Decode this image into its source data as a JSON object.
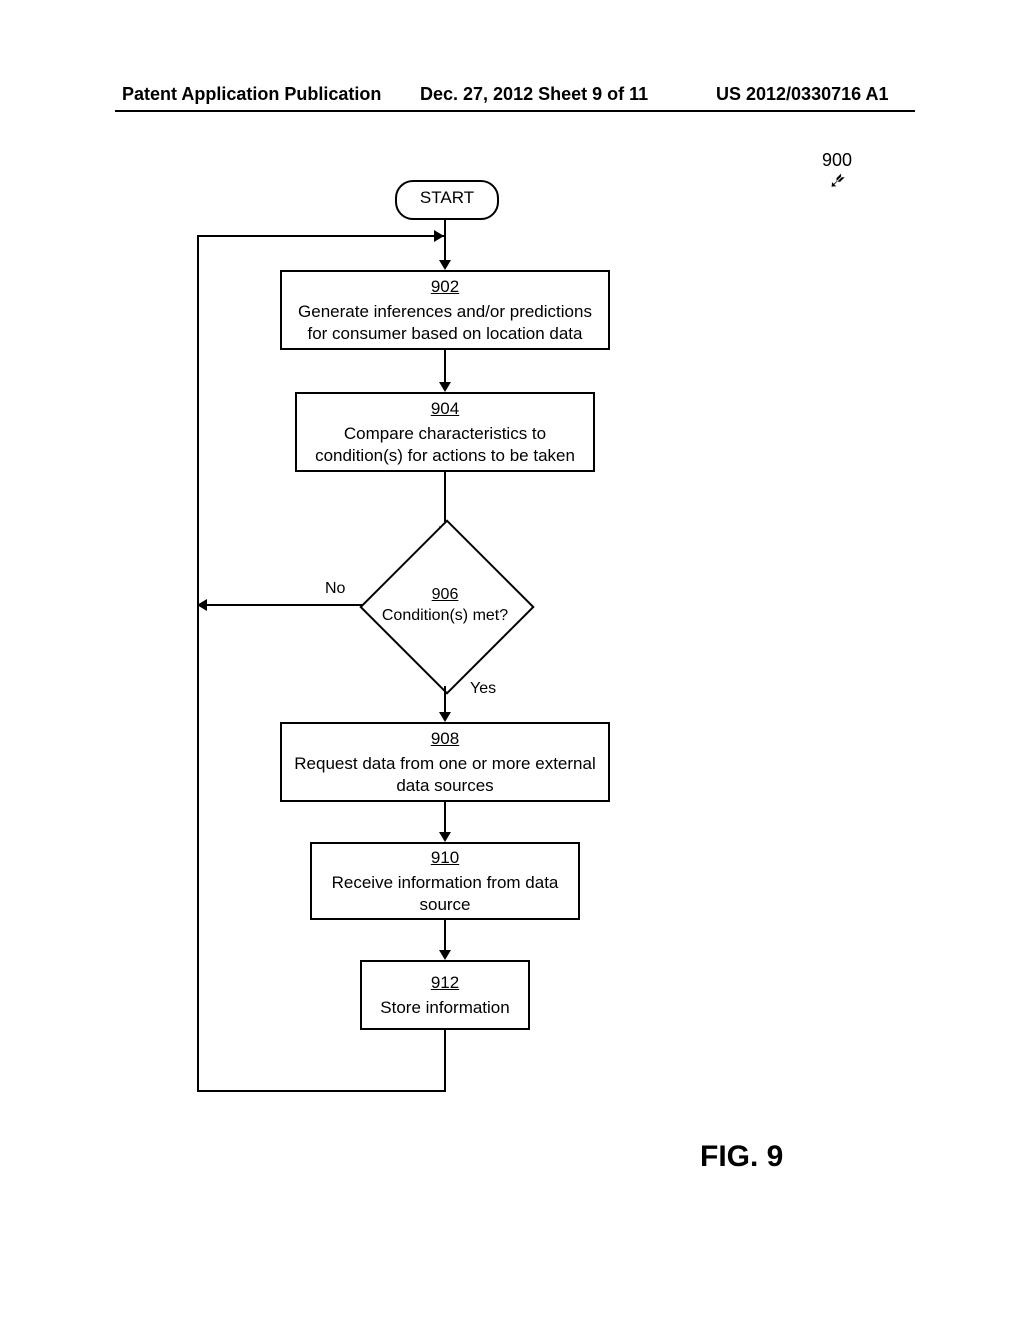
{
  "header": {
    "left": "Patent Application Publication",
    "mid": "Dec. 27, 2012  Sheet 9 of 11",
    "right": "US 2012/0330716 A1"
  },
  "figure": {
    "ref": "900",
    "label": "FIG. 9"
  },
  "flow": {
    "start": "START",
    "b902": {
      "num": "902",
      "text": "Generate inferences and/or predictions for consumer based on location data"
    },
    "b904": {
      "num": "904",
      "text": "Compare characteristics to condition(s) for actions to be taken"
    },
    "d906": {
      "num": "906",
      "text": "Condition(s) met?"
    },
    "b908": {
      "num": "908",
      "text": "Request data from one or more external data sources"
    },
    "b910": {
      "num": "910",
      "text": "Receive information from data source"
    },
    "b912": {
      "num": "912",
      "text": "Store information"
    },
    "labels": {
      "no": "No",
      "yes": "Yes"
    }
  }
}
